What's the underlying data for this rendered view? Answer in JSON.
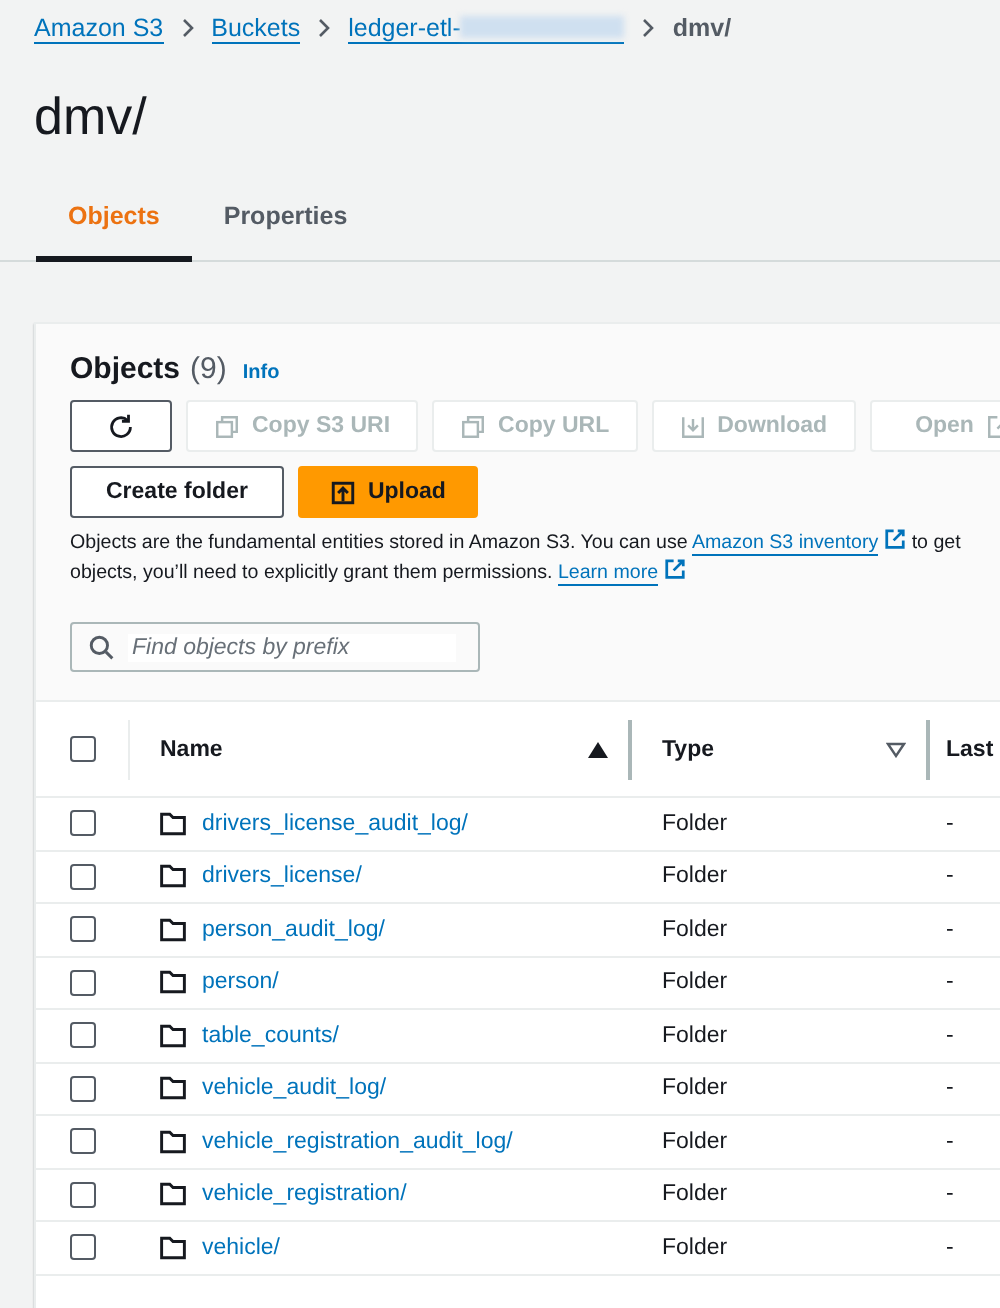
{
  "breadcrumbs": [
    {
      "label": "Amazon S3",
      "link": true,
      "redacted": false
    },
    {
      "label": "Buckets",
      "link": true,
      "redacted": false
    },
    {
      "label": "ledger-etl-",
      "link": true,
      "redacted": true
    },
    {
      "label": "dmv/",
      "link": false,
      "redacted": false
    }
  ],
  "title": "dmv/",
  "tabs": [
    {
      "label": "Objects",
      "selected": true
    },
    {
      "label": "Properties",
      "selected": false
    }
  ],
  "panel": {
    "title": "Objects",
    "count": "(9)",
    "info": "Info",
    "actions": [
      {
        "kind": "refresh",
        "disabled": false
      },
      {
        "kind": "copy",
        "label": "Copy S3 URI",
        "disabled": true
      },
      {
        "kind": "copy",
        "label": "Copy URL",
        "disabled": true
      },
      {
        "kind": "download",
        "label": "Download",
        "disabled": true
      },
      {
        "kind": "open",
        "label": "Open",
        "disabled": true
      }
    ],
    "buttons": [
      {
        "kind": "normal",
        "label": "Create folder"
      },
      {
        "kind": "primary",
        "label": "Upload"
      }
    ],
    "description": [
      [
        {
          "text": "Objects are the fundamental entities stored in Amazon S3. You can use ",
          "link": false
        },
        {
          "text": "Amazon S3 inventory",
          "link": true
        },
        {
          "text": " to get",
          "link": false
        }
      ],
      [
        {
          "text": "objects, you’ll need to explicitly grant them permissions. ",
          "link": false
        },
        {
          "text": "Learn more",
          "link": true
        }
      ]
    ],
    "search": {
      "placeholder": "Find objects by prefix"
    }
  },
  "table": {
    "columns": [
      {
        "label": "Name",
        "sorted": true
      },
      {
        "label": "Type",
        "sorted": false
      },
      {
        "label": "Last"
      }
    ],
    "select_all": {
      "checked": false
    },
    "rows": [
      {
        "name": "drivers_license_audit_log/",
        "type": "Folder",
        "column_3": "-",
        "checked": false
      },
      {
        "name": "drivers_license/",
        "type": "Folder",
        "column_3": "-",
        "checked": false
      },
      {
        "name": "person_audit_log/",
        "type": "Folder",
        "column_3": "-",
        "checked": false
      },
      {
        "name": "person/",
        "type": "Folder",
        "column_3": "-",
        "checked": false
      },
      {
        "name": "table_counts/",
        "type": "Folder",
        "column_3": "-",
        "checked": false
      },
      {
        "name": "vehicle_audit_log/",
        "type": "Folder",
        "column_3": "-",
        "checked": false
      },
      {
        "name": "vehicle_registration_audit_log/",
        "type": "Folder",
        "column_3": "-",
        "checked": false
      },
      {
        "name": "vehicle_registration/",
        "type": "Folder",
        "column_3": "-",
        "checked": false
      },
      {
        "name": "vehicle/",
        "type": "Folder",
        "column_3": "-",
        "checked": false
      }
    ]
  }
}
